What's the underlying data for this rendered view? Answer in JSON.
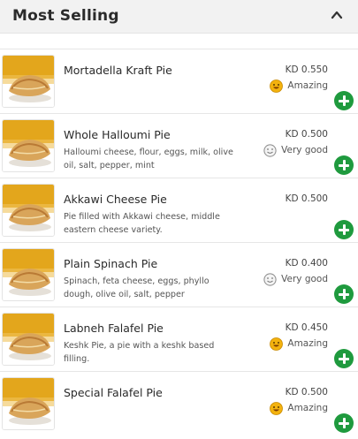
{
  "header": {
    "title": "Most Selling",
    "collapse_icon": "chevron-up-icon"
  },
  "items": [
    {
      "name": "Mortadella Kraft Pie",
      "description": "",
      "price": "KD 0.550",
      "rating": "Amazing",
      "rating_icon": "amazing-face-icon"
    },
    {
      "name": "Whole Halloumi Pie",
      "description": "Halloumi cheese, flour, eggs, milk, olive oil, salt, pepper, mint",
      "price": "KD 0.500",
      "rating": "Very good",
      "rating_icon": "very-good-face-icon"
    },
    {
      "name": "Akkawi Cheese Pie",
      "description": "Pie filled with Akkawi cheese, middle eastern cheese variety.",
      "price": "KD 0.500",
      "rating": "",
      "rating_icon": ""
    },
    {
      "name": "Plain Spinach Pie",
      "description": "Spinach, feta cheese, eggs, phyllo dough, olive oil, salt, pepper",
      "price": "KD 0.400",
      "rating": "Very good",
      "rating_icon": "very-good-face-icon"
    },
    {
      "name": "Labneh Falafel Pie",
      "description": "Keshk Pie, a pie with a keshk based filling.",
      "price": "KD 0.450",
      "rating": "Amazing",
      "rating_icon": "amazing-face-icon"
    },
    {
      "name": "Special Falafel Pie",
      "description": "",
      "price": "KD 0.500",
      "rating": "Amazing",
      "rating_icon": "amazing-face-icon"
    }
  ],
  "colors": {
    "add_button": "#1f9a3e",
    "thumb_backdrop": "#e3a61c",
    "amazing_face": "#f3b20e"
  }
}
